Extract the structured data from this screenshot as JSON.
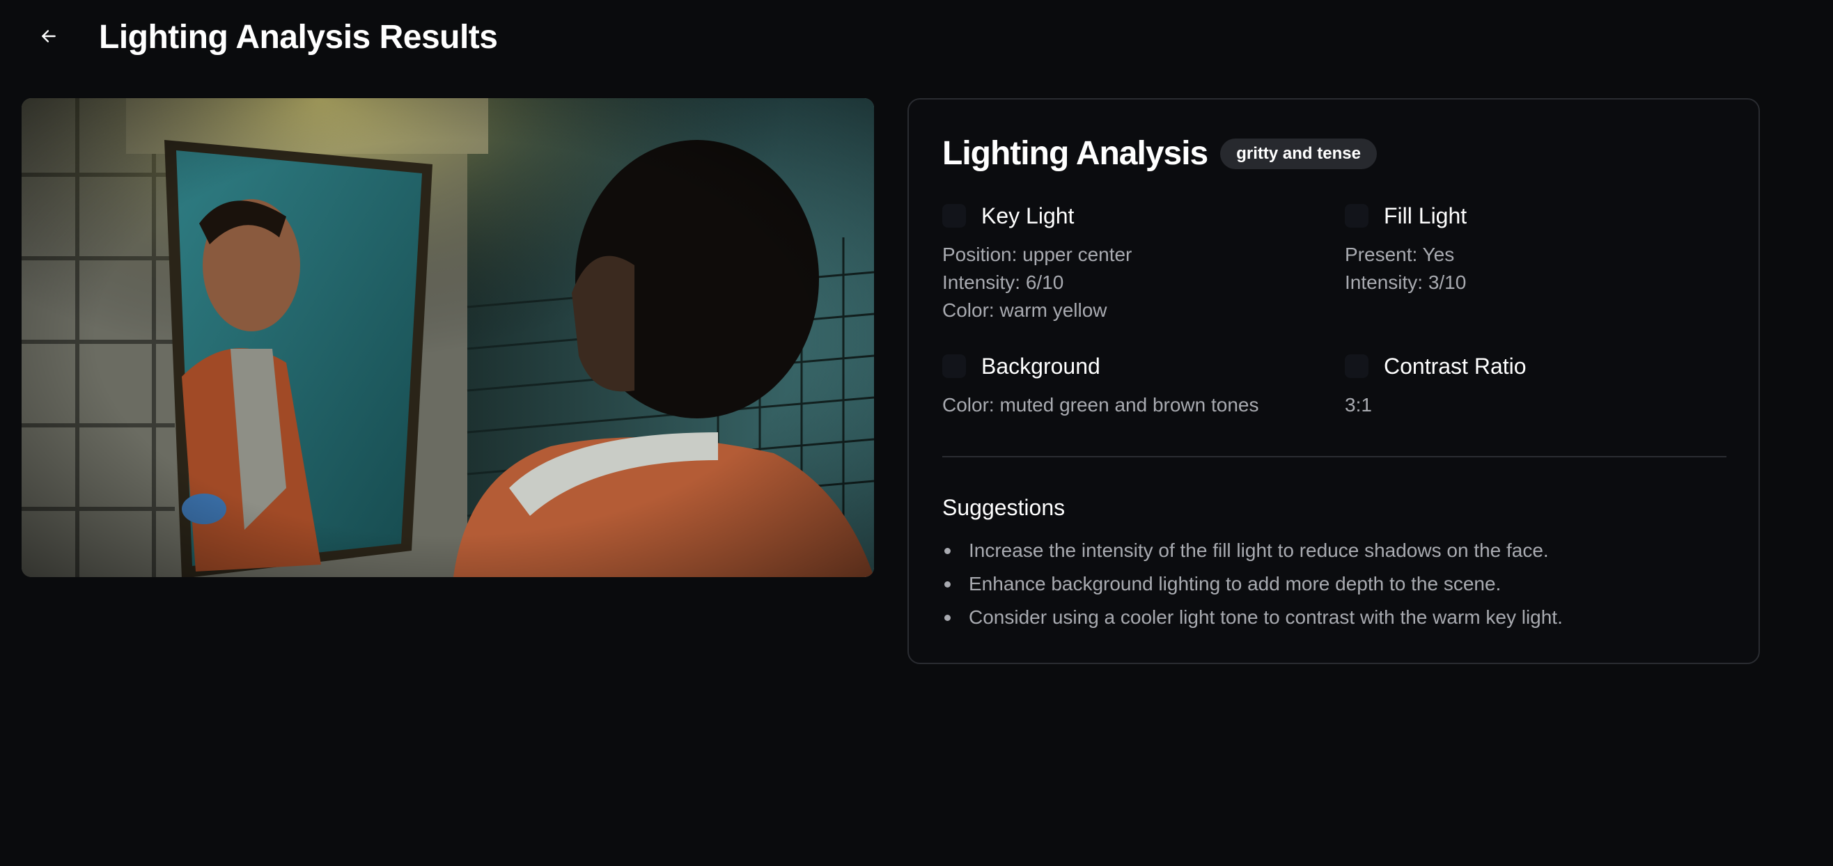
{
  "header": {
    "back_icon": "arrow-left-icon",
    "title": "Lighting Analysis Results"
  },
  "image": {
    "subject": "man looking at mirror reflection in tiled bathroom"
  },
  "analysis": {
    "title": "Lighting Analysis",
    "mood": "gritty and tense",
    "key_light": {
      "title": "Key Light",
      "lines": [
        "Position: upper center",
        "Intensity: 6/10",
        "Color: warm yellow"
      ]
    },
    "fill_light": {
      "title": "Fill Light",
      "lines": [
        "Present: Yes",
        "Intensity: 3/10"
      ]
    },
    "background": {
      "title": "Background",
      "lines": [
        "Color: muted green and brown tones"
      ]
    },
    "contrast_ratio": {
      "title": "Contrast Ratio",
      "lines": [
        "3:1"
      ]
    },
    "suggestions": {
      "title": "Suggestions",
      "items": [
        "Increase the intensity of the fill light to reduce shadows on the face.",
        "Enhance background lighting to add more depth to the scene.",
        "Consider using a cooler light tone to contrast with the warm key light."
      ]
    }
  },
  "colors": {
    "background": "#0a0b0d",
    "card_border": "#2a2c31",
    "badge": "#27292e",
    "muted_text": "#a9abb1"
  }
}
